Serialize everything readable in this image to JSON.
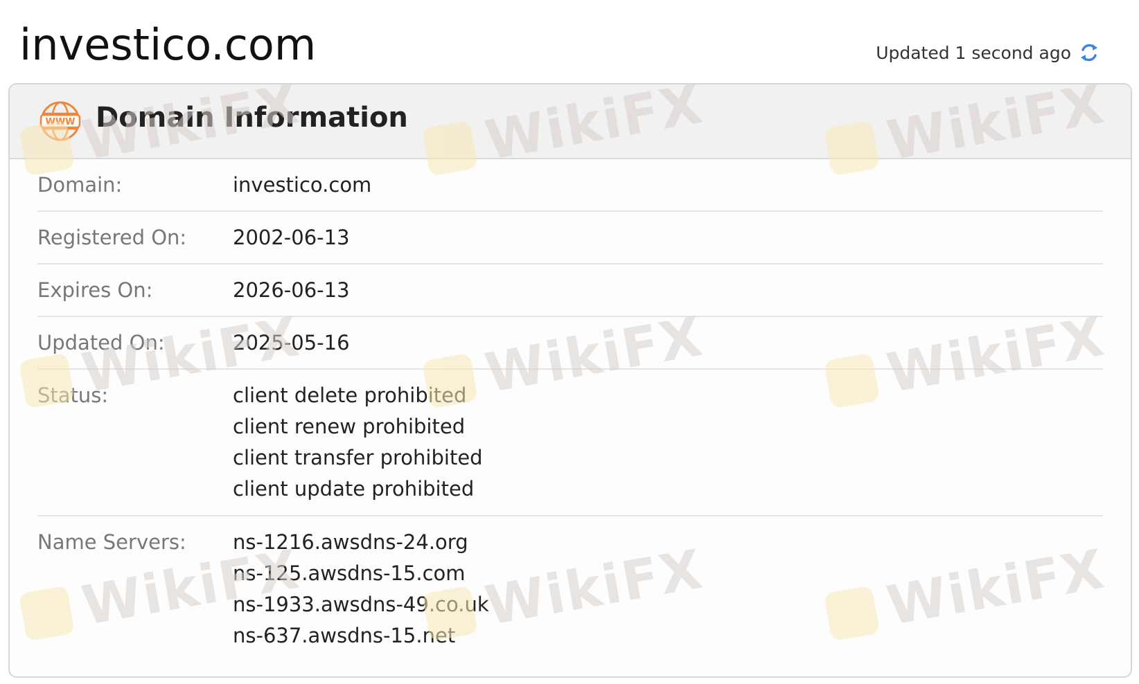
{
  "page": {
    "title": "investico.com",
    "updated_text": "Updated 1 second ago"
  },
  "card": {
    "title": "Domain Information",
    "rows": {
      "domain": {
        "label": "Domain:",
        "value": "investico.com"
      },
      "registered": {
        "label": "Registered On:",
        "value": "2002-06-13"
      },
      "expires": {
        "label": "Expires On:",
        "value": "2026-06-13"
      },
      "updated": {
        "label": "Updated On:",
        "value": "2025-05-16"
      },
      "status": {
        "label": "Status:",
        "values": [
          "client delete prohibited",
          "client renew prohibited",
          "client transfer prohibited",
          "client update prohibited"
        ]
      },
      "name_servers": {
        "label": "Name Servers:",
        "values": [
          "ns-1216.awsdns-24.org",
          "ns-125.awsdns-15.com",
          "ns-1933.awsdns-49.co.uk",
          "ns-637.awsdns-15.net"
        ]
      }
    }
  },
  "watermark": {
    "text": "WikiFX"
  },
  "icons": {
    "header": "www-globe-icon",
    "refresh": "refresh-icon"
  },
  "colors": {
    "accent_orange": "#f0853a",
    "refresh_blue": "#3a86e0"
  }
}
